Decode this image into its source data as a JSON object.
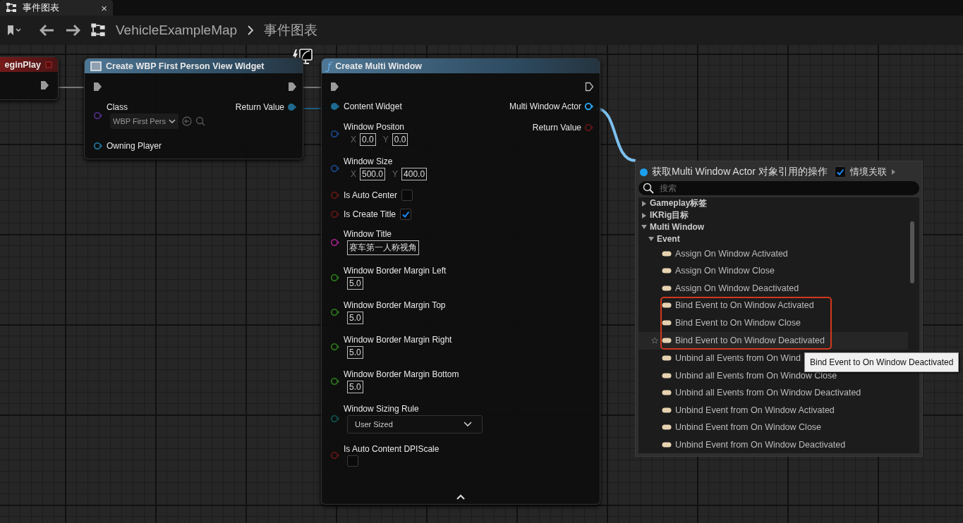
{
  "tab": {
    "title": "事件图表",
    "close": "×"
  },
  "toolbar": {
    "breadcrumb": [
      "VehicleExampleMap",
      "事件图表"
    ]
  },
  "nodes": [
    {
      "kind": "event",
      "title": "eginPlay",
      "exec_out": {
        "filled": true
      }
    },
    {
      "kind": "widget",
      "title": "Create WBP First Person View Widget",
      "client_only": true,
      "exec_in": {
        "filled": true
      },
      "exec_out": {
        "filled": true
      },
      "inputs": [
        {
          "kind": "class",
          "name": "Class",
          "color": "#4a2a78",
          "filled": false,
          "value": "WBP First Pers"
        },
        {
          "kind": "object",
          "name": "Owning Player",
          "color": "#1f6a90",
          "filled": false
        }
      ],
      "outputs": [
        {
          "name": "Return Value",
          "color": "#1f6a90",
          "filled": true
        }
      ]
    },
    {
      "kind": "function",
      "icon": "ƒ",
      "title": "Create Multi Window",
      "exec_in": {
        "filled": true
      },
      "exec_out": {
        "filled": false
      },
      "inputs": [
        {
          "kind": "object",
          "name": "Content Widget",
          "color": "#1f6a90",
          "filled": true
        },
        {
          "kind": "vector",
          "name": "Window Positon",
          "color": "#1a3f7a",
          "filled": false,
          "fields": [
            {
              "axis": "X",
              "value": "0.0"
            },
            {
              "axis": "Y",
              "value": "0.0"
            }
          ]
        },
        {
          "kind": "vector",
          "name": "Window Size",
          "color": "#1a3f7a",
          "filled": false,
          "fields": [
            {
              "axis": "X",
              "value": "500.0"
            },
            {
              "axis": "Y",
              "value": "400.0"
            }
          ]
        },
        {
          "kind": "bool",
          "name": "Is Auto Center",
          "color": "#5a1515",
          "filled": false,
          "checked": false
        },
        {
          "kind": "bool",
          "name": "Is Create Title",
          "color": "#5a1515",
          "filled": false,
          "checked": true
        },
        {
          "kind": "text",
          "name": "Window Title",
          "color": "#8a1f78",
          "filled": false,
          "value": "赛车第一人称视角"
        },
        {
          "kind": "number",
          "name": "Window Border Margin Left",
          "color": "#2a6a1a",
          "filled": false,
          "value": "5.0"
        },
        {
          "kind": "number",
          "name": "Window Border Margin Top",
          "color": "#2a6a1a",
          "filled": false,
          "value": "5.0"
        },
        {
          "kind": "number",
          "name": "Window Border Margin Right",
          "color": "#2a6a1a",
          "filled": false,
          "value": "5.0"
        },
        {
          "kind": "number",
          "name": "Window Border Margin Bottom",
          "color": "#2a6a1a",
          "filled": false,
          "value": "5.0"
        },
        {
          "kind": "enum",
          "name": "Window Sizing Rule",
          "color": "#0f4a48",
          "filled": false,
          "value": "User Sized"
        },
        {
          "kind": "boolbelow",
          "name": "Is Auto Content DPIScale",
          "color": "#5a1515",
          "filled": false,
          "checked": false
        }
      ],
      "outputs": [
        {
          "name": "Multi Window Actor",
          "color": "#2aa0e8",
          "filled": false
        },
        {
          "name": "Return Value",
          "color": "#5a1515",
          "filled": false
        }
      ]
    }
  ],
  "action_menu": {
    "title": "获取Multi Window Actor 对象引用的操作",
    "context": {
      "label": "情境关联",
      "checked": true
    },
    "search": {
      "placeholder": "搜索"
    },
    "tree": [
      {
        "label": "Gameplay标签",
        "expanded": false
      },
      {
        "label": "IKRig目标",
        "expanded": false
      },
      {
        "label": "Multi Window",
        "expanded": true,
        "children": [
          {
            "label": "Event",
            "expanded": true,
            "children": [
              {
                "label": "Assign On Window Activated",
                "selected": false
              },
              {
                "label": "Assign On Window Close",
                "selected": false
              },
              {
                "label": "Assign On Window Deactivated",
                "selected": false
              },
              {
                "kind": "highlight_group",
                "children": [
                  {
                    "label": "Bind Event to On Window Activated",
                    "selected": false
                  },
                  {
                    "label": "Bind Event to On Window Close",
                    "selected": false
                  },
                  {
                    "label": "Bind Event to On Window Deactivated",
                    "selected": true
                  }
                ]
              },
              {
                "label": "Unbind all Events from On Wind",
                "selected": false
              },
              {
                "label": "Unbind all Events from On Window Close",
                "selected": false
              },
              {
                "label": "Unbind all Events from On Window Deactivated",
                "selected": false
              },
              {
                "label": "Unbind Event from On Window Activated",
                "selected": false
              },
              {
                "label": "Unbind Event from On Window Close",
                "selected": false
              },
              {
                "label": "Unbind Event from On Window Deactivated",
                "selected": false
              }
            ]
          }
        ]
      }
    ]
  },
  "tooltip": {
    "text": "Bind Event to On Window Deactivated"
  }
}
